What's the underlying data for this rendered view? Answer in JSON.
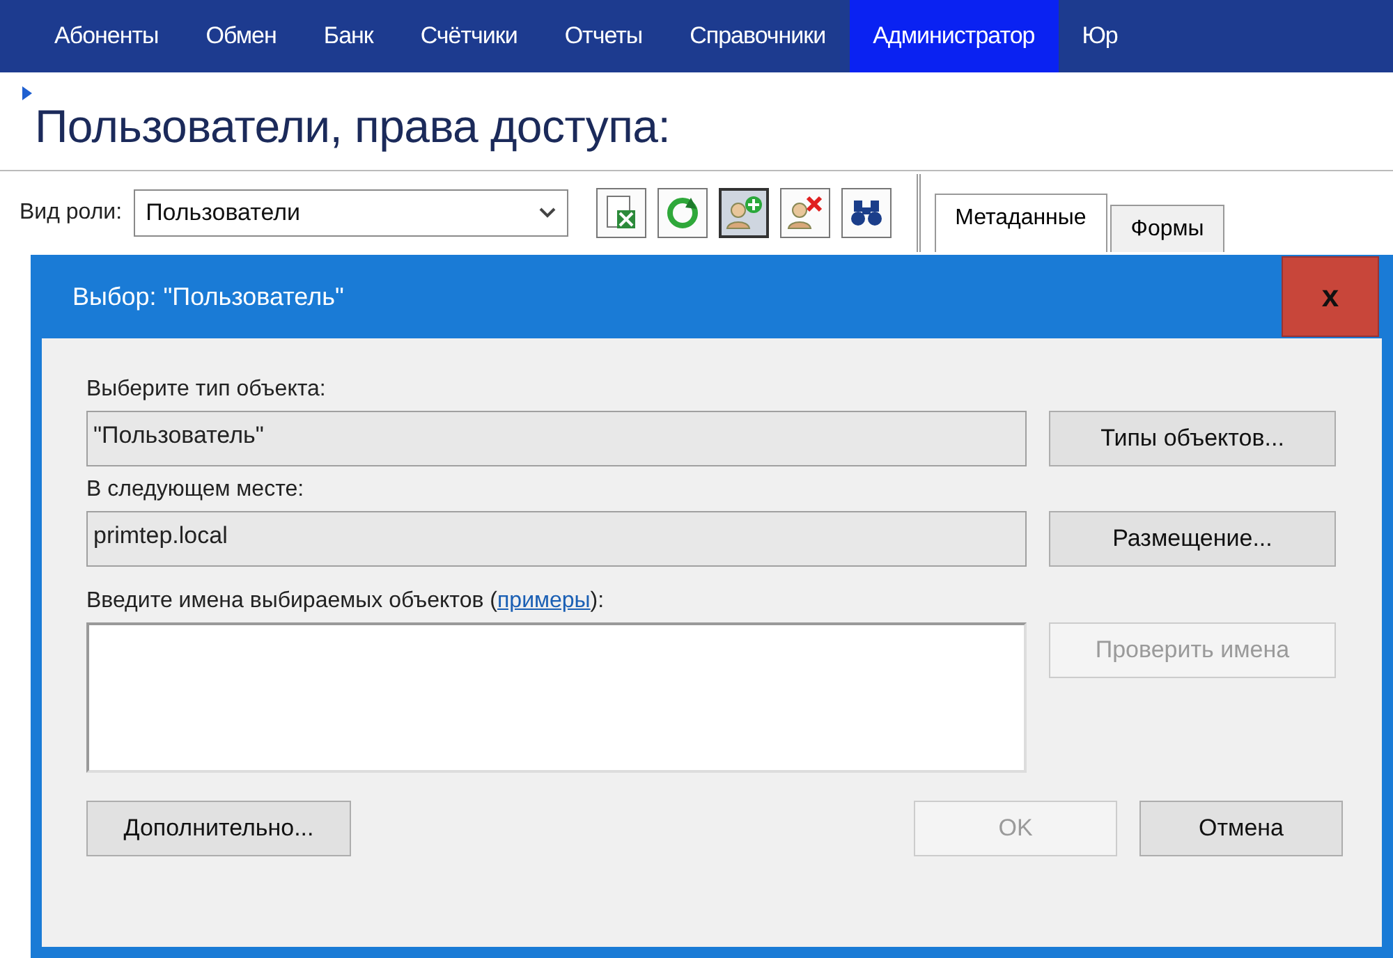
{
  "menu": [
    {
      "label": "Абоненты",
      "selected": false
    },
    {
      "label": "Обмен",
      "selected": false
    },
    {
      "label": "Банк",
      "selected": false
    },
    {
      "label": "Счётчики",
      "selected": false
    },
    {
      "label": "Отчеты",
      "selected": false
    },
    {
      "label": "Справочники",
      "selected": false
    },
    {
      "label": "Администратор",
      "selected": true
    },
    {
      "label": "Юр",
      "selected": false
    }
  ],
  "page_title": "Пользователи, права доступа:",
  "toolbar": {
    "role_label": "Вид роли:",
    "role_value": "Пользователи",
    "buttons": [
      {
        "kind": "excel",
        "pressed": false
      },
      {
        "kind": "refresh",
        "pressed": false
      },
      {
        "kind": "add-user",
        "pressed": true
      },
      {
        "kind": "remove-user",
        "pressed": false
      },
      {
        "kind": "find",
        "pressed": false
      }
    ]
  },
  "tabs": [
    {
      "label": "Метаданные",
      "selected": true
    },
    {
      "label": "Формы",
      "selected": false
    }
  ],
  "dialog": {
    "title": "Выбор: \"Пользователь\"",
    "close": "x",
    "type_label": "Выберите тип объекта:",
    "type_value": "\"Пользователь\"",
    "type_button": "Типы объектов...",
    "location_label": "В следующем месте:",
    "location_value": "primtep.local",
    "location_button": "Размещение...",
    "names_label_before": "Введите имена выбираемых объектов (",
    "names_link": "примеры",
    "names_label_after": "):",
    "check_button": {
      "label": "Проверить имена",
      "disabled": true
    },
    "advanced_button": "Дополнительно...",
    "ok_button": {
      "label": "OK",
      "disabled": true
    },
    "cancel_button": {
      "label": "Отмена",
      "disabled": false
    }
  }
}
